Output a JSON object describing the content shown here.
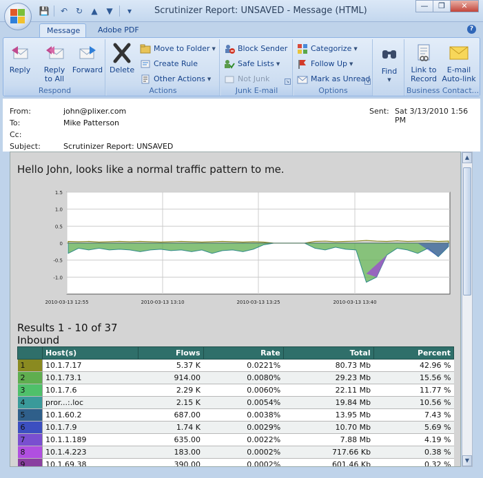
{
  "window": {
    "title": "Scrutinizer Report: UNSAVED  -  Message (HTML)",
    "minimize": "—",
    "maximize": "❐",
    "close": "✕"
  },
  "qat": {
    "save": "💾",
    "undo": "↶",
    "redo": "↻",
    "up": "▲",
    "down": "▼",
    "more": "▾"
  },
  "tabs": [
    {
      "label": "Message",
      "active": true
    },
    {
      "label": "Adobe PDF",
      "active": false
    }
  ],
  "help": "?",
  "ribbon": {
    "respond": {
      "label": "Respond",
      "reply": "Reply",
      "reply_all_1": "Reply",
      "reply_all_2": "to All",
      "forward": "Forward"
    },
    "actions": {
      "label": "Actions",
      "delete": "Delete",
      "move_to_folder": "Move to Folder",
      "create_rule": "Create Rule",
      "other_actions": "Other Actions"
    },
    "junk": {
      "label": "Junk E-mail",
      "block_sender": "Block Sender",
      "safe_lists": "Safe Lists",
      "not_junk": "Not Junk"
    },
    "options": {
      "label": "Options",
      "categorize": "Categorize",
      "follow_up": "Follow Up",
      "mark_unread": "Mark as Unread"
    },
    "find": {
      "label": "Find"
    },
    "business": {
      "label": "Business Contact...",
      "link_record_1": "Link to",
      "link_record_2": "Record",
      "email_autolink_1": "E-mail",
      "email_autolink_2": "Auto-link"
    }
  },
  "header": {
    "from_label": "From:",
    "from": "john@plixer.com",
    "to_label": "To:",
    "to": "Mike Patterson",
    "cc_label": "Cc:",
    "cc": "",
    "subject_label": "Subject:",
    "subject": "Scrutinizer Report: UNSAVED",
    "sent_label": "Sent:",
    "sent": "Sat 3/13/2010 1:56 PM"
  },
  "body": {
    "greeting": "Hello John, looks like a normal traffic pattern to me.",
    "results_title": "Results 1 - 10 of 37",
    "results_sub": "Inbound"
  },
  "chart_data": {
    "type": "area",
    "ylim": [
      -1.5,
      1.5
    ],
    "yticks": [
      "1.5",
      "1.0",
      "0.5",
      "0",
      "-0.5",
      "-1.0"
    ],
    "xticks": [
      "2010-03-13 12:55",
      "2010-03-13 13:10",
      "2010-03-13 13:25",
      "2010-03-13 13:40"
    ],
    "grid": true,
    "colors": {
      "olive": "#8a8a20",
      "green": "#5fae4f",
      "teal": "#2f8a88",
      "purple": "#9b4fd0",
      "blue": "#3c4fc0",
      "gray": "#d8d8d8"
    },
    "series": [
      {
        "values": [
          0.05,
          0.04,
          0.05,
          0.03,
          0.04,
          0.05,
          0.04,
          0.05,
          0.04,
          0.03,
          0.04,
          0.05,
          0.04,
          0.03,
          0.04,
          0.05,
          0.04,
          0.03,
          0.04,
          0.03,
          0.0,
          0.0,
          0.0,
          0.0,
          0.05,
          0.06,
          0.04,
          0.05,
          0.06,
          0.08,
          0.06,
          0.05,
          0.07,
          0.05,
          0.06,
          0.07,
          0.05,
          0.06
        ]
      },
      {
        "values": [
          -0.3,
          -0.15,
          -0.2,
          -0.15,
          -0.2,
          -0.18,
          -0.2,
          -0.25,
          -0.2,
          -0.18,
          -0.22,
          -0.2,
          -0.25,
          -0.2,
          -0.3,
          -0.22,
          -0.2,
          -0.25,
          -0.18,
          -0.05,
          0.0,
          0.0,
          0.0,
          0.0,
          -0.15,
          -0.2,
          -0.12,
          -0.18,
          -0.2,
          -1.15,
          -1.0,
          -0.35,
          -0.15,
          -0.2,
          -0.3,
          -0.15,
          -0.4,
          -0.1
        ]
      }
    ]
  },
  "table": {
    "headers": [
      "Host(s)",
      "Flows",
      "Rate",
      "Total",
      "Percent"
    ],
    "rows": [
      {
        "idx": "1",
        "color": "#8a8a20",
        "host": "10.1.7.17",
        "flows": "5.37 K",
        "rate": "0.0221%",
        "total": "80.73 Mb",
        "percent": "42.96 %"
      },
      {
        "idx": "2",
        "color": "#5fae4f",
        "host": "10.1.73.1",
        "flows": "914.00",
        "rate": "0.0080%",
        "total": "29.23 Mb",
        "percent": "15.56 %"
      },
      {
        "idx": "3",
        "color": "#4fc06a",
        "host": "10.1.7.6",
        "flows": "2.29 K",
        "rate": "0.0060%",
        "total": "22.11 Mb",
        "percent": "11.77 %"
      },
      {
        "idx": "4",
        "color": "#3a9a9a",
        "host": "pror...:.loc",
        "flows": "2.15 K",
        "rate": "0.0054%",
        "total": "19.84 Mb",
        "percent": "10.56 %"
      },
      {
        "idx": "5",
        "color": "#2f5f8a",
        "host": "10.1.60.2",
        "flows": "687.00",
        "rate": "0.0038%",
        "total": "13.95 Mb",
        "percent": "7.43 %"
      },
      {
        "idx": "6",
        "color": "#3c4fc0",
        "host": "10.1.7.9",
        "flows": "1.74 K",
        "rate": "0.0029%",
        "total": "10.70 Mb",
        "percent": "5.69 %"
      },
      {
        "idx": "7",
        "color": "#7a4fd0",
        "host": "10.1.1.189",
        "flows": "635.00",
        "rate": "0.0022%",
        "total": "7.88 Mb",
        "percent": "4.19 %"
      },
      {
        "idx": "8",
        "color": "#b04fe0",
        "host": "10.1.4.223",
        "flows": "183.00",
        "rate": "0.0002%",
        "total": "717.66 Kb",
        "percent": "0.38 %"
      },
      {
        "idx": "9",
        "color": "#8a3fa0",
        "host": "10.1.69.38",
        "flows": "390.00",
        "rate": "0.0002%",
        "total": "601.46 Kb",
        "percent": "0.32 %"
      }
    ]
  }
}
